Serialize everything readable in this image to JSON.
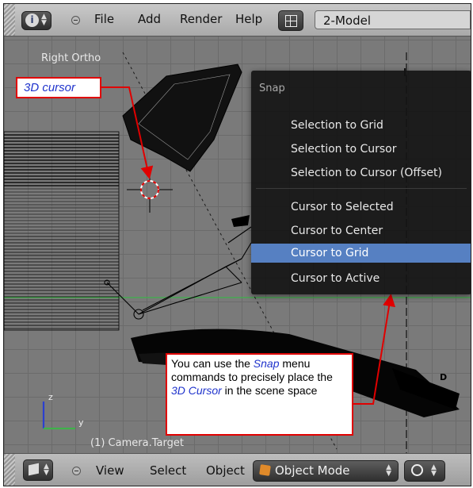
{
  "header": {
    "menus": [
      "File",
      "Add",
      "Render",
      "Help"
    ],
    "layout_name": "2-Model",
    "info_icon": "info-icon",
    "layout_icon": "screen-layout-icon"
  },
  "viewport": {
    "view_label": "Right Ortho",
    "object_label": "(1) Camera.Target",
    "axis_z": "z",
    "axis_y": "y",
    "corner_letter": "D"
  },
  "snap_menu": {
    "title": "Snap",
    "items": [
      "Selection to Grid",
      "Selection to Cursor",
      "Selection to Cursor (Offset)",
      "Cursor to Selected",
      "Cursor to Center",
      "Cursor to Grid",
      "Cursor to Active"
    ],
    "highlighted_item": "Cursor to Grid"
  },
  "annotations": {
    "cursor_callout": "3D cursor",
    "snap_callout": {
      "t1": "You can use the ",
      "t2": "Snap",
      "t3": " menu commands to precisely place the ",
      "t4": "3D Cursor",
      "t5": " in the scene space"
    }
  },
  "footer": {
    "menus": [
      "View",
      "Select",
      "Object"
    ],
    "mode": "Object Mode",
    "mode_icon": "object-mode-cube-icon",
    "shading_icon": "viewport-shading-sphere-icon"
  },
  "colors": {
    "menu_highlight": "#5680c2",
    "callout_border": "#e00000",
    "callout_accent_text": "#1f33cc",
    "grid_bg": "#7a7a7a"
  }
}
